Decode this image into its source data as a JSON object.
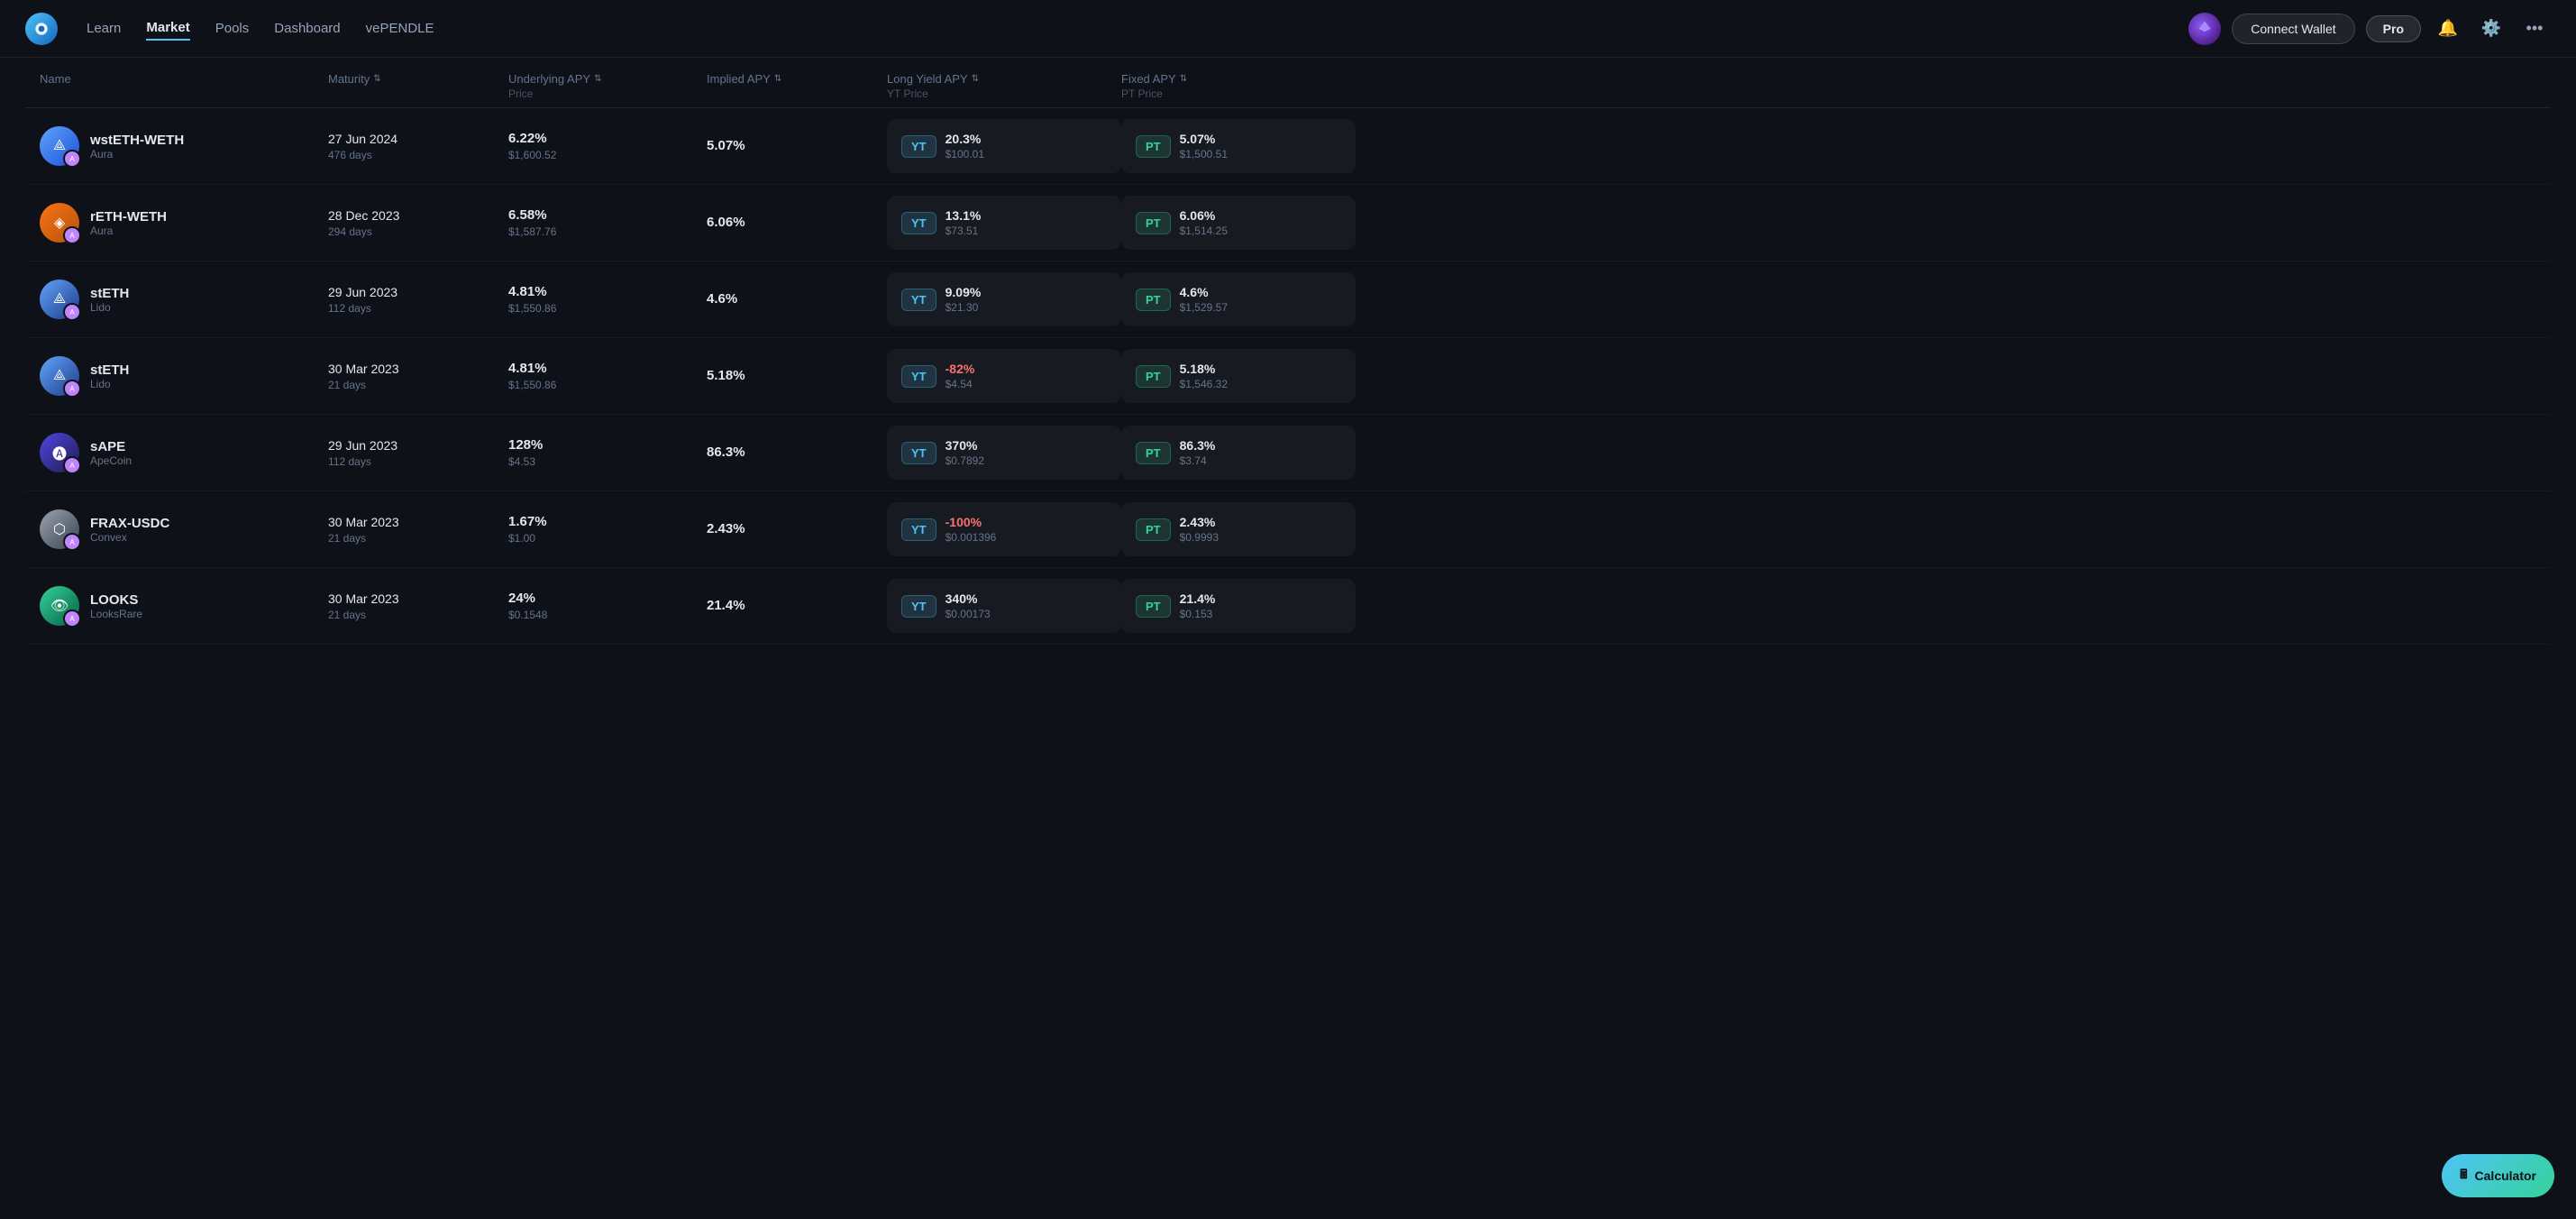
{
  "nav": {
    "links": [
      {
        "label": "Learn",
        "active": false
      },
      {
        "label": "Market",
        "active": true
      },
      {
        "label": "Pools",
        "active": false
      },
      {
        "label": "Dashboard",
        "active": false
      },
      {
        "label": "vePENDLE",
        "active": false
      }
    ],
    "connect_wallet": "Connect Wallet",
    "pro_label": "Pro"
  },
  "table": {
    "columns": [
      {
        "label": "Name",
        "sublabel": ""
      },
      {
        "label": "Maturity",
        "sublabel": "",
        "sortable": true
      },
      {
        "label": "Underlying APY",
        "sublabel": "Price",
        "sortable": true
      },
      {
        "label": "Implied APY",
        "sublabel": "",
        "sortable": true
      },
      {
        "label": "Long Yield APY",
        "sublabel": "YT Price",
        "sortable": true
      },
      {
        "label": "Fixed APY",
        "sublabel": "PT Price",
        "sortable": true
      }
    ],
    "rows": [
      {
        "name": "wstETH-WETH",
        "provider": "Aura",
        "icon_type": "wsteth",
        "maturity_date": "27 Jun 2024",
        "maturity_days": "476 days",
        "underlying_apy": "6.22%",
        "underlying_price": "$1,600.52",
        "implied_apy": "5.07%",
        "yt_apy": "20.3%",
        "yt_price": "$100.01",
        "pt_apy": "5.07%",
        "pt_price": "$1,500.51"
      },
      {
        "name": "rETH-WETH",
        "provider": "Aura",
        "icon_type": "reth",
        "maturity_date": "28 Dec 2023",
        "maturity_days": "294 days",
        "underlying_apy": "6.58%",
        "underlying_price": "$1,587.76",
        "implied_apy": "6.06%",
        "yt_apy": "13.1%",
        "yt_price": "$73.51",
        "pt_apy": "6.06%",
        "pt_price": "$1,514.25"
      },
      {
        "name": "stETH",
        "provider": "Lido",
        "icon_type": "steth",
        "maturity_date": "29 Jun 2023",
        "maturity_days": "112 days",
        "underlying_apy": "4.81%",
        "underlying_price": "$1,550.86",
        "implied_apy": "4.6%",
        "yt_apy": "9.09%",
        "yt_price": "$21.30",
        "pt_apy": "4.6%",
        "pt_price": "$1,529.57"
      },
      {
        "name": "stETH",
        "provider": "Lido",
        "icon_type": "steth",
        "maturity_date": "30 Mar 2023",
        "maturity_days": "21 days",
        "underlying_apy": "4.81%",
        "underlying_price": "$1,550.86",
        "implied_apy": "5.18%",
        "yt_apy": "-82%",
        "yt_price": "$4.54",
        "pt_apy": "5.18%",
        "pt_price": "$1,546.32",
        "yt_negative": true
      },
      {
        "name": "sAPE",
        "provider": "ApeCoin",
        "icon_type": "sape",
        "maturity_date": "29 Jun 2023",
        "maturity_days": "112 days",
        "underlying_apy": "128%",
        "underlying_price": "$4.53",
        "implied_apy": "86.3%",
        "yt_apy": "370%",
        "yt_price": "$0.7892",
        "pt_apy": "86.3%",
        "pt_price": "$3.74"
      },
      {
        "name": "FRAX-USDC",
        "provider": "Convex",
        "icon_type": "frax",
        "maturity_date": "30 Mar 2023",
        "maturity_days": "21 days",
        "underlying_apy": "1.67%",
        "underlying_price": "$1.00",
        "implied_apy": "2.43%",
        "yt_apy": "-100%",
        "yt_price": "$0.001396",
        "pt_apy": "2.43%",
        "pt_price": "$0.9993",
        "yt_negative": true
      },
      {
        "name": "LOOKS",
        "provider": "LooksRare",
        "icon_type": "looks",
        "maturity_date": "30 Mar 2023",
        "maturity_days": "21 days",
        "underlying_apy": "24%",
        "underlying_price": "$0.1548",
        "implied_apy": "21.4%",
        "yt_apy": "340%",
        "yt_price": "$0.00173",
        "pt_apy": "21.4%",
        "pt_price": "$0.153"
      }
    ]
  },
  "calculator": {
    "label": "Calculator"
  }
}
